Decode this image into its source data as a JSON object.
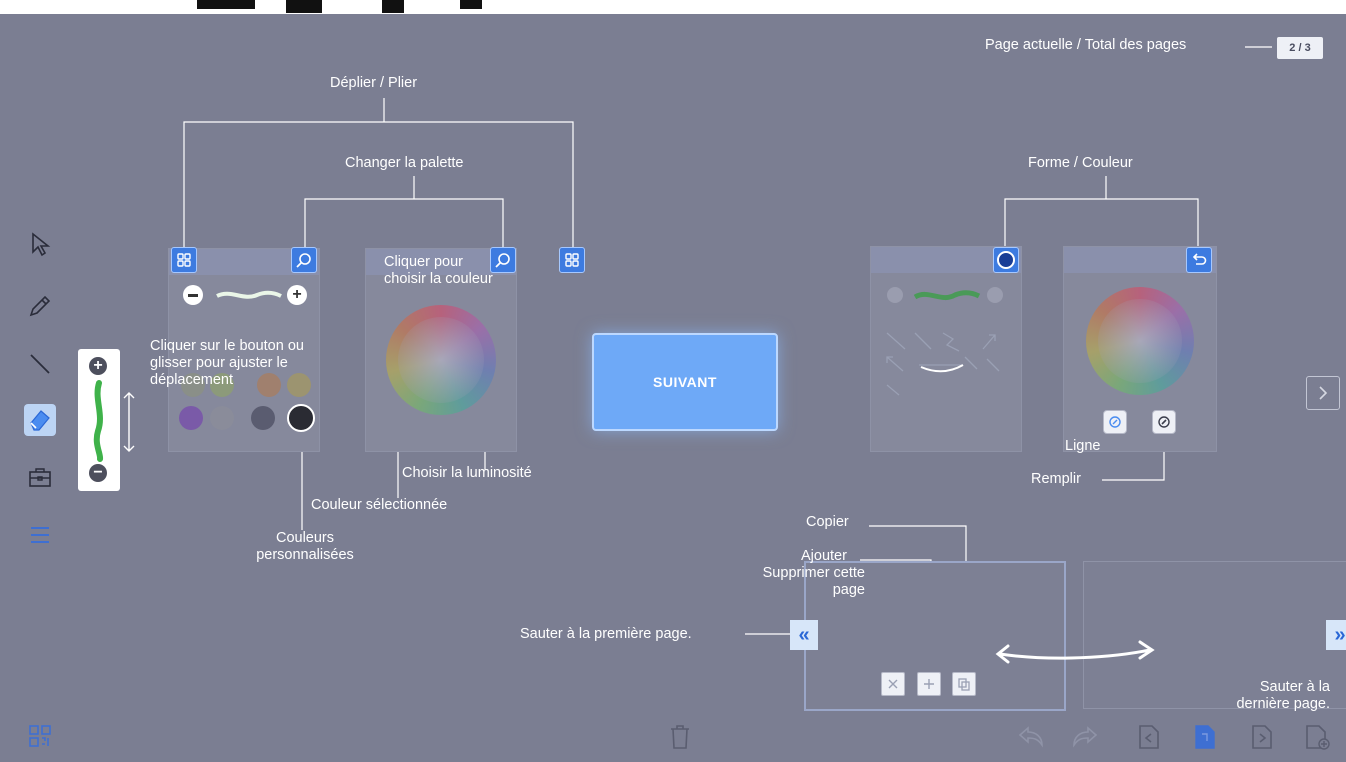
{
  "colors": {
    "background": "#7b7e92",
    "accent_blue": "#4a8cf0",
    "suivant_button": "#6ea9f7",
    "active_tool_bg": "#bcd4f4",
    "green_stroke": "#3fb24a"
  },
  "page_indicator": {
    "label": "Page actuelle / Total des pages",
    "value": "2 / 3"
  },
  "toolbar": {
    "tools": [
      {
        "icon": "cursor-icon"
      },
      {
        "icon": "pencil-icon"
      },
      {
        "icon": "line-icon"
      },
      {
        "icon": "eraser-icon",
        "active": true
      },
      {
        "icon": "toolbox-icon"
      },
      {
        "icon": "menu-icon"
      }
    ],
    "bottom_icon": "qr-code-icon"
  },
  "annotations": {
    "deplier": "Déplier / Plier",
    "changer_palette": "Changer la palette",
    "forme_couleur": "Forme / Couleur",
    "cliquer_bouton": "Cliquer sur le bouton ou glisser pour ajuster le déplacement",
    "cliquer_couleur": "Cliquer pour choisir la couleur",
    "choisir_luminosite": "Choisir la luminosité",
    "couleur_selectionnee": "Couleur sélectionnée",
    "couleurs_perso": "Couleurs personnalisées",
    "ligne": "Ligne",
    "remplir": "Remplir",
    "copier": "Copier",
    "ajouter": "Ajouter",
    "supprimer": "Supprimer cette page",
    "sauter_premiere": "Sauter à la première page.",
    "sauter_derniere": "Sauter à la dernière page."
  },
  "main": {
    "next_button": "SUIVANT"
  },
  "palette": {
    "custom_colors": [
      "#7a5aa8",
      "#8a8c9a",
      "#5a5c70",
      "#2a2b33"
    ],
    "faded_colors": [
      "#8a8f88",
      "#8c9a7a",
      "#a0806e",
      "#9c9470"
    ]
  },
  "bottom_bar": {
    "icons": [
      "trash-icon",
      "undo-icon",
      "redo-icon",
      "prev-page-icon",
      "current-page-icon",
      "next-page-icon",
      "add-page-icon"
    ]
  }
}
